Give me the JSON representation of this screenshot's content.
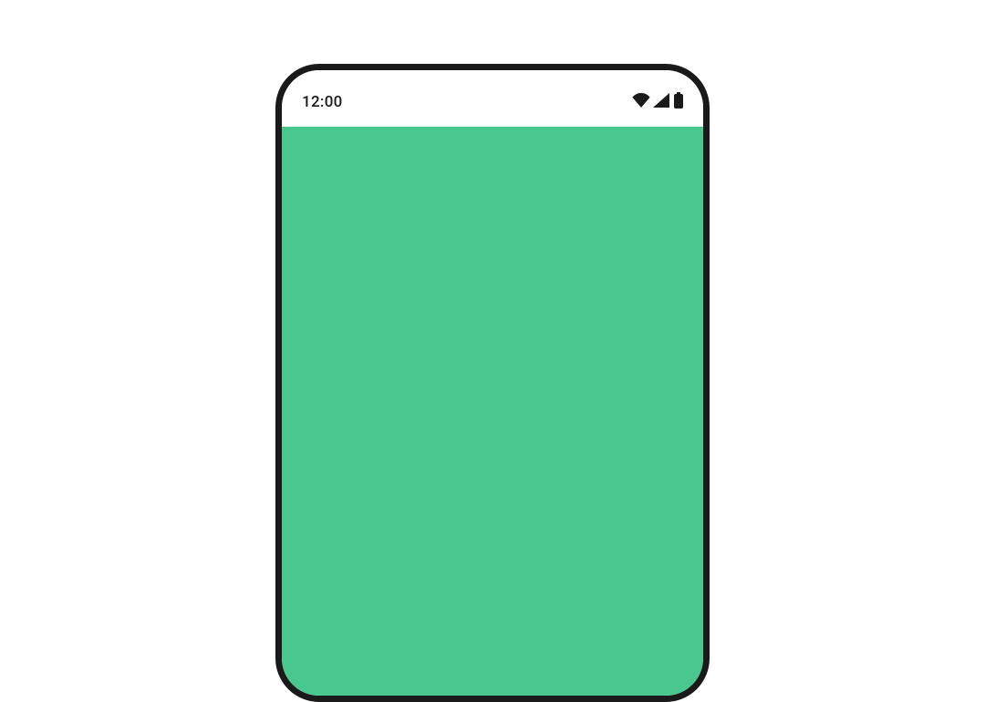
{
  "statusbar": {
    "time": "12:00"
  },
  "colors": {
    "content_background": "#48c88f",
    "frame_border": "#1a1a1a",
    "status_background": "#ffffff"
  }
}
